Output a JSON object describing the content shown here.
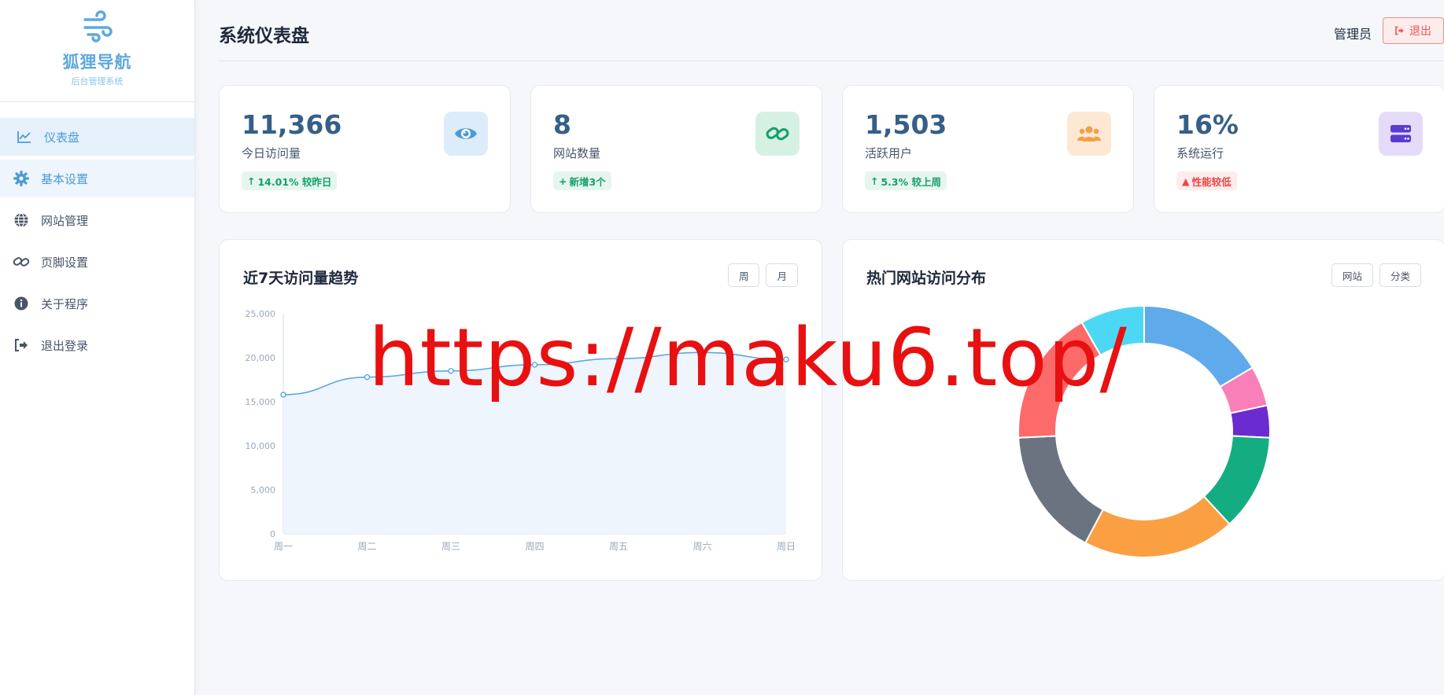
{
  "brand": {
    "name": "狐狸导航",
    "subtitle": "后台管理系统"
  },
  "sidebar": {
    "items": [
      {
        "label": "仪表盘",
        "icon": "chart-line-icon"
      },
      {
        "label": "基本设置",
        "icon": "gear-icon"
      },
      {
        "label": "网站管理",
        "icon": "globe-icon"
      },
      {
        "label": "页脚设置",
        "icon": "link-icon"
      },
      {
        "label": "关于程序",
        "icon": "info-icon"
      },
      {
        "label": "退出登录",
        "icon": "sign-out-icon"
      }
    ]
  },
  "header": {
    "title": "系统仪表盘",
    "user": "管理员",
    "logout_label": "退出"
  },
  "stats": [
    {
      "value": "11,366",
      "label": "今日访问量",
      "badge": "14.01% 较昨日",
      "badge_arrow": "↑",
      "icon": "eye-icon",
      "icon_color": "#4a9ad6",
      "icon_bg": "#dcecfa"
    },
    {
      "value": "8",
      "label": "网站数量",
      "badge": "新增3个",
      "badge_arrow": "+",
      "icon": "link-icon",
      "icon_color": "#16a06a",
      "icon_bg": "#d6f1e4"
    },
    {
      "value": "1,503",
      "label": "活跃用户",
      "badge": "5.3% 较上周",
      "badge_arrow": "↑",
      "icon": "users-icon",
      "icon_color": "#f59e42",
      "icon_bg": "#fde8d4"
    },
    {
      "value": "16%",
      "label": "系统运行",
      "badge": "性能较低",
      "badge_arrow": "▲",
      "icon": "server-icon",
      "icon_color": "#5b3bd0",
      "icon_bg": "#e4dbf8"
    }
  ],
  "visits_chart": {
    "title": "近7天访问量趋势",
    "buttons": [
      "周",
      "月"
    ]
  },
  "distribution_chart": {
    "title": "热门网站访问分布",
    "buttons": [
      "网站",
      "分类"
    ]
  },
  "chart_data": [
    {
      "type": "area",
      "x": [
        "周一",
        "周二",
        "周三",
        "周四",
        "周五",
        "周六",
        "周日"
      ],
      "y": [
        15800,
        17800,
        18500,
        19200,
        19900,
        20600,
        19800
      ],
      "ylim": [
        0,
        25000
      ],
      "yticks": [
        "0",
        "5,000",
        "10,000",
        "15,000",
        "20,000",
        "25,000"
      ],
      "ytick_values": [
        0,
        5000,
        10000,
        15000,
        20000,
        25000
      ],
      "color": "#5aa7e2",
      "fill": "#eef5fc"
    },
    {
      "type": "pie",
      "donut": true,
      "values": [
        16,
        5,
        4,
        12,
        19,
        16,
        17,
        8
      ],
      "colors": [
        "#5eaaeb",
        "#f87fb8",
        "#6a2bd0",
        "#14ad82",
        "#fba042",
        "#6b7380",
        "#fd6a6a",
        "#4cd8f5"
      ]
    }
  ],
  "watermark": "https://maku6.top/"
}
